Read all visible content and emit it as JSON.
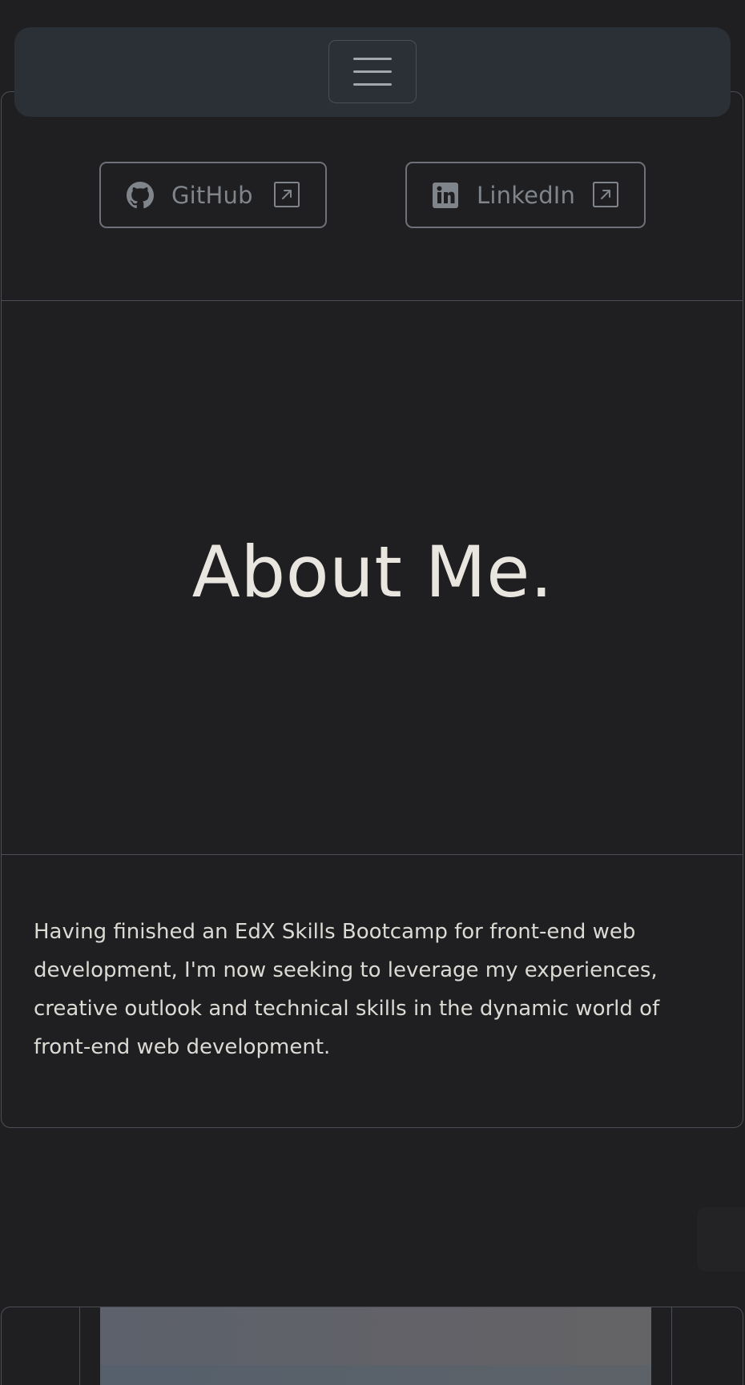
{
  "navbar": {
    "menu_icon": "hamburger-menu-icon"
  },
  "social": {
    "github": {
      "label": "GitHub",
      "icon": "github-icon",
      "external_icon": "external-link-icon"
    },
    "linkedin": {
      "label": "LinkedIn",
      "icon": "linkedin-icon",
      "external_icon": "external-link-icon"
    }
  },
  "about": {
    "title": "About Me.",
    "bio": "Having finished an EdX Skills Bootcamp for front-end web development, I'm now seeking to leverage my experiences, creative outlook and technical skills in the dynamic world of front-end web development."
  },
  "colors": {
    "background": "#1f1f21",
    "navbar": "#2b2f36",
    "border": "#4b4f55",
    "heading_text": "#e8e6df",
    "muted_text": "#80858c"
  }
}
